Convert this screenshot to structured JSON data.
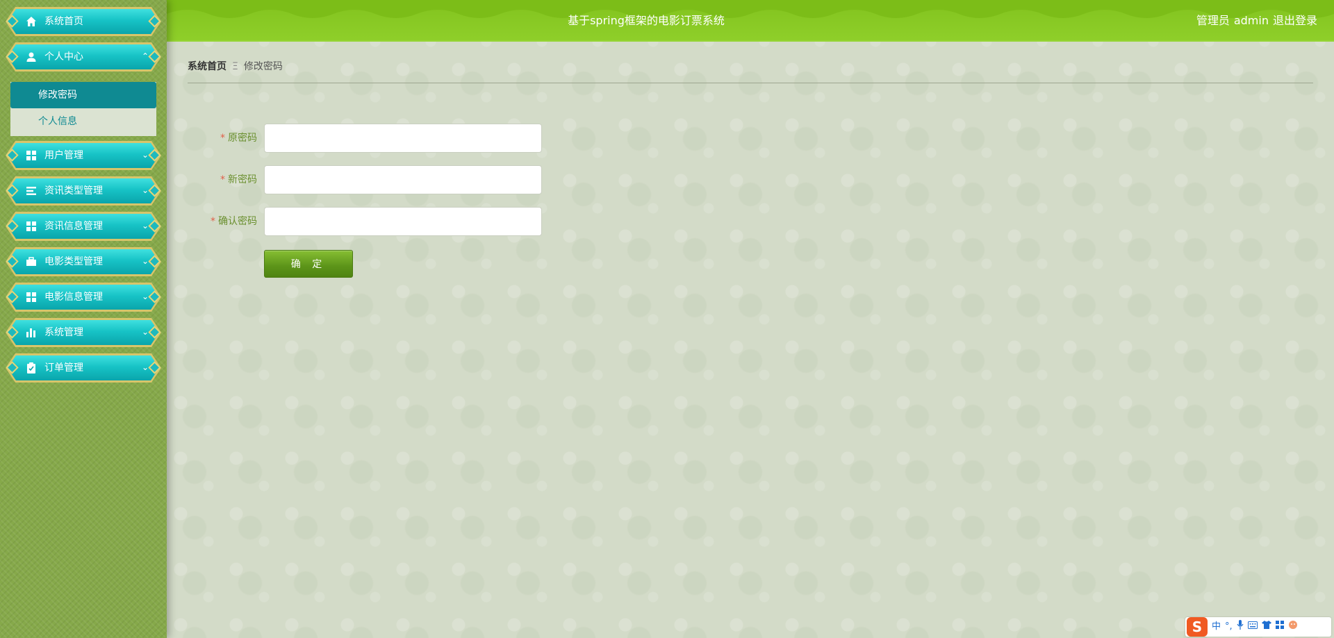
{
  "header": {
    "title": "基于spring框架的电影订票系统",
    "role": "管理员",
    "username": "admin",
    "logout": "退出登录"
  },
  "sidebar": {
    "items": [
      {
        "label": "系统首页",
        "icon": "home-icon",
        "chevron": ""
      },
      {
        "label": "个人中心",
        "icon": "user-icon",
        "chevron": "⌃"
      },
      {
        "label": "用户管理",
        "icon": "grid-icon",
        "chevron": "⌄"
      },
      {
        "label": "资讯类型管理",
        "icon": "list-icon",
        "chevron": "⌄"
      },
      {
        "label": "资讯信息管理",
        "icon": "grid-icon",
        "chevron": "⌄"
      },
      {
        "label": "电影类型管理",
        "icon": "briefcase-icon",
        "chevron": "⌄"
      },
      {
        "label": "电影信息管理",
        "icon": "grid-icon",
        "chevron": "⌄"
      },
      {
        "label": "系统管理",
        "icon": "bar-chart-icon",
        "chevron": "⌄"
      },
      {
        "label": "订单管理",
        "icon": "clipboard-icon",
        "chevron": "⌄"
      }
    ],
    "submenu": [
      {
        "label": "修改密码",
        "active": true
      },
      {
        "label": "个人信息",
        "active": false
      }
    ]
  },
  "breadcrumb": {
    "home": "系统首页",
    "separator": "Ξ",
    "current": "修改密码"
  },
  "form": {
    "required_mark": "*",
    "fields": [
      {
        "label": "原密码",
        "value": "",
        "placeholder": ""
      },
      {
        "label": "新密码",
        "value": "",
        "placeholder": ""
      },
      {
        "label": "确认密码",
        "value": "",
        "placeholder": ""
      }
    ],
    "submit_label": "确 定"
  },
  "ime": {
    "logo": "S",
    "mode": "中"
  },
  "colors": {
    "header_green": "#86c622",
    "sidebar_green": "#86a94a",
    "menu_teal": "#17c3c6",
    "menu_gold": "#d8c56a",
    "active_sub": "#0f8a92",
    "button_green": "#5c9419",
    "label_green": "#6a8f2e",
    "required_red": "#e0604a"
  }
}
